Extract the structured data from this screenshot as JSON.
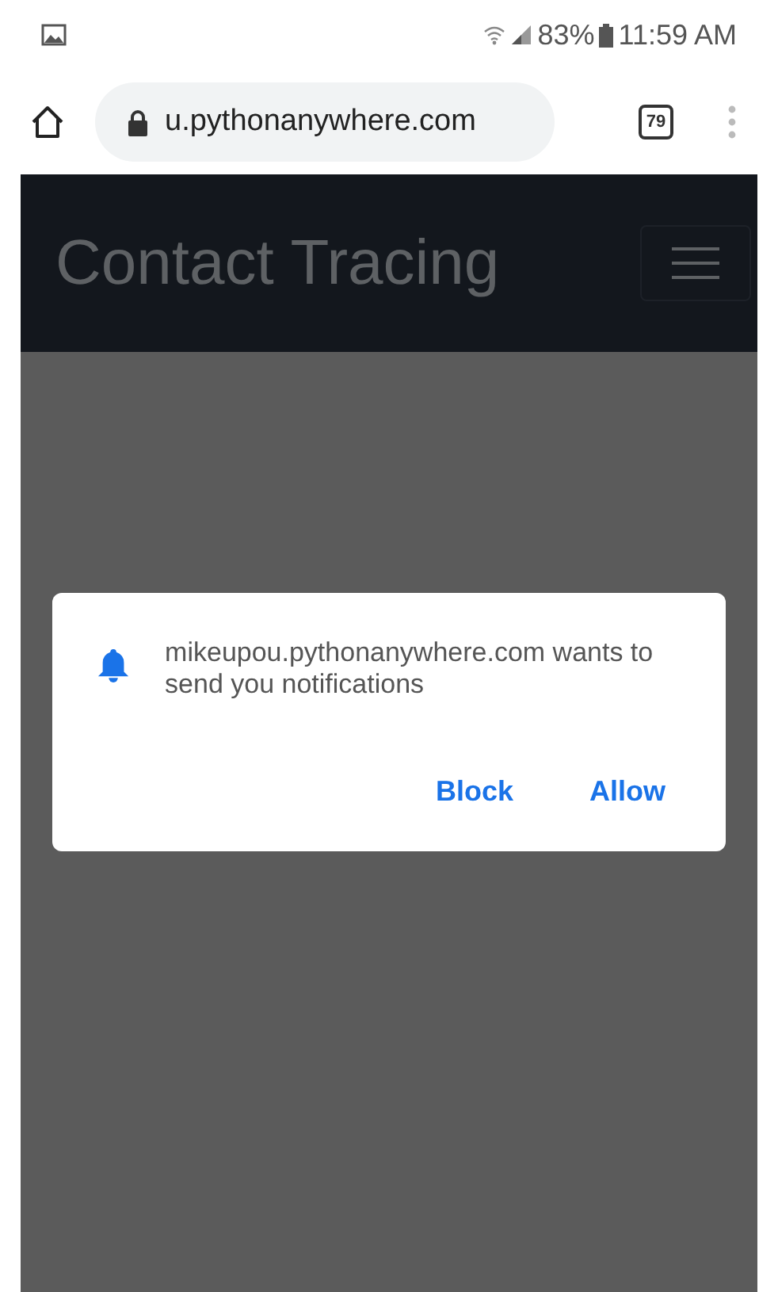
{
  "status_bar": {
    "battery": "83%",
    "time": "11:59 AM"
  },
  "browser": {
    "url": "u.pythonanywhere.com",
    "tab_count": "79"
  },
  "navbar": {
    "brand": "Contact Tracing"
  },
  "dialog": {
    "message": "mikeupou.pythonanywhere.com wants to send you notifications",
    "buttons": [
      "Block",
      "Allow"
    ]
  }
}
